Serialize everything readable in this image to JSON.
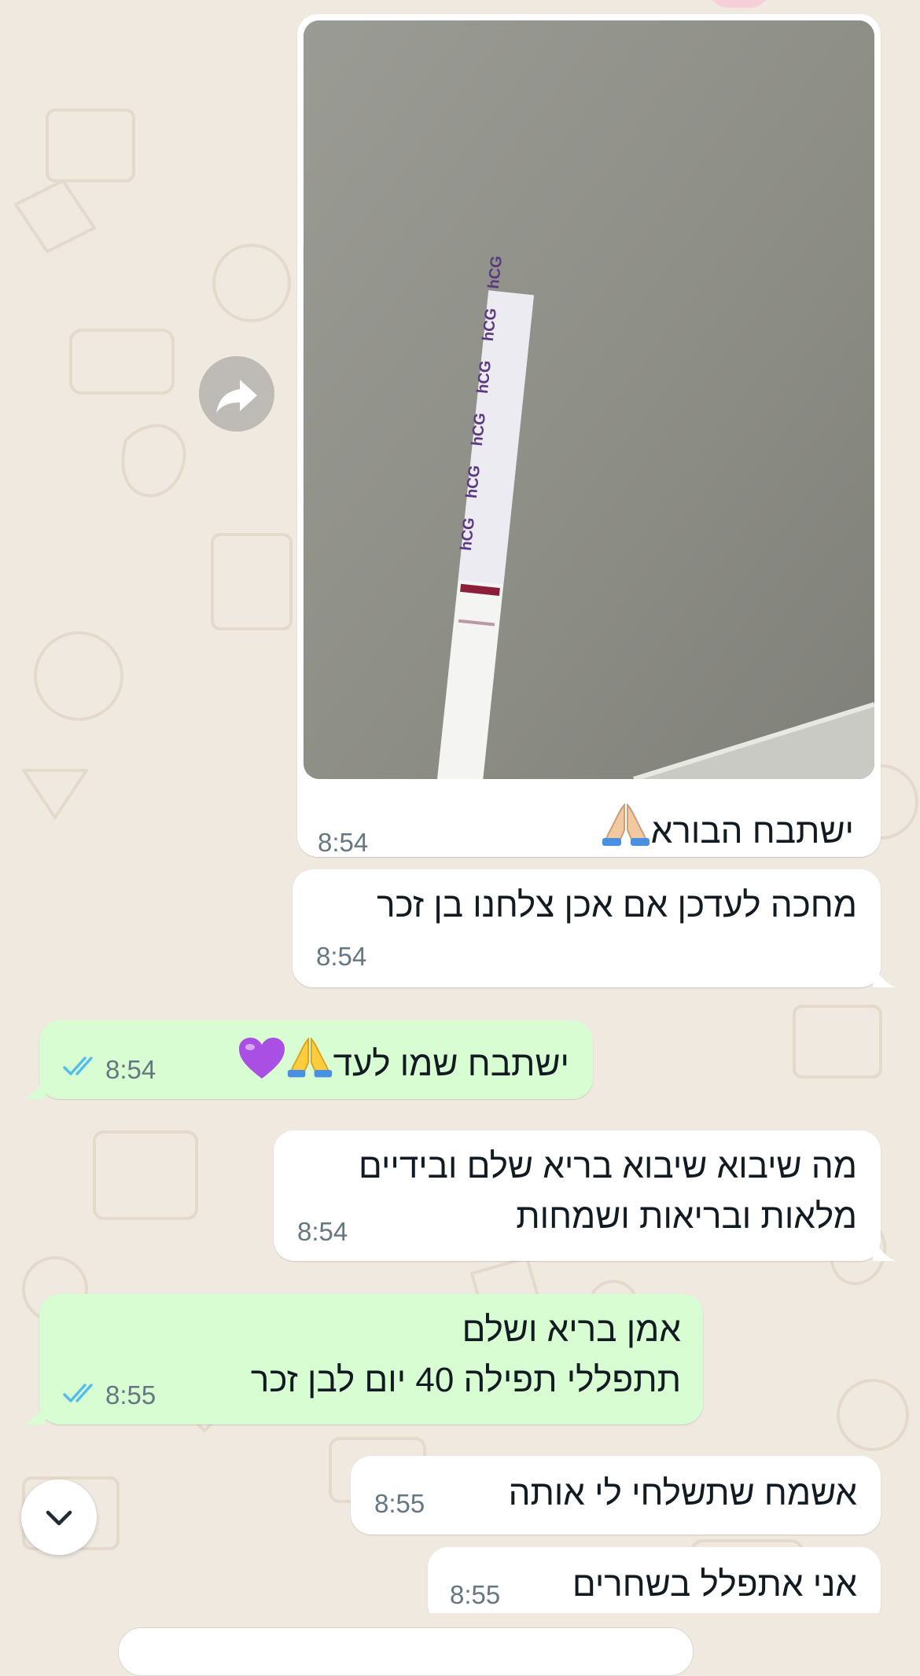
{
  "photo": {
    "strip_words": [
      "hCG",
      "hCG",
      "hCG",
      "hCG",
      "hCG",
      "hCG"
    ]
  },
  "messages": [
    {
      "dir": "in",
      "text": "ישתבח הבורא",
      "emoji": "pray",
      "time": "8:54"
    },
    {
      "dir": "in",
      "text": "מחכה לעדכן אם אכן צלחנו בן זכר",
      "time": "8:54"
    },
    {
      "dir": "out",
      "text": "ישתבח שמו לעד",
      "emoji": "pray purple-heart",
      "time": "8:54",
      "status": "read"
    },
    {
      "dir": "in",
      "lines": [
        "מה שיבוא שיבוא בריא שלם ובידיים",
        "מלאות ובריאות ושמחות"
      ],
      "time": "8:54"
    },
    {
      "dir": "out",
      "lines": [
        "אמן בריא ושלם",
        "תתפללי תפילה 40 יום לבן זכר"
      ],
      "time": "8:55",
      "status": "read"
    },
    {
      "dir": "in",
      "text": "אשמח שתשלחי לי אותה",
      "time": "8:55"
    },
    {
      "dir": "in",
      "text": "אני אתפלל בשחרים",
      "time": "8:55"
    }
  ],
  "colors": {
    "incoming_bubble": "#ffffff",
    "outgoing_bubble": "#d9fdd3",
    "chat_background": "#efe9e0",
    "read_ticks": "#53bdeb",
    "time": "#667781"
  }
}
